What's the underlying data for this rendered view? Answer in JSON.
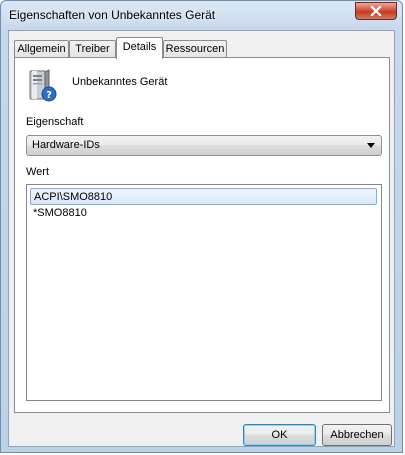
{
  "window": {
    "title": "Eigenschaften von Unbekanntes Gerät",
    "close_icon": "close-icon"
  },
  "tabs": [
    {
      "label": "Allgemein",
      "active": false
    },
    {
      "label": "Treiber",
      "active": false
    },
    {
      "label": "Details",
      "active": true
    },
    {
      "label": "Ressourcen",
      "active": false
    }
  ],
  "details": {
    "device_icon": "unknown-device-icon",
    "device_name": "Unbekanntes Gerät",
    "property_label": "Eigenschaft",
    "property_selected": "Hardware-IDs",
    "value_label": "Wert",
    "values": [
      "ACPI\\SMO8810",
      "*SMO8810"
    ],
    "selected_index": 0
  },
  "buttons": {
    "ok": "OK",
    "cancel": "Abbrechen"
  },
  "colors": {
    "selection_border": "#84acdd",
    "close_button": "#c23c22"
  }
}
